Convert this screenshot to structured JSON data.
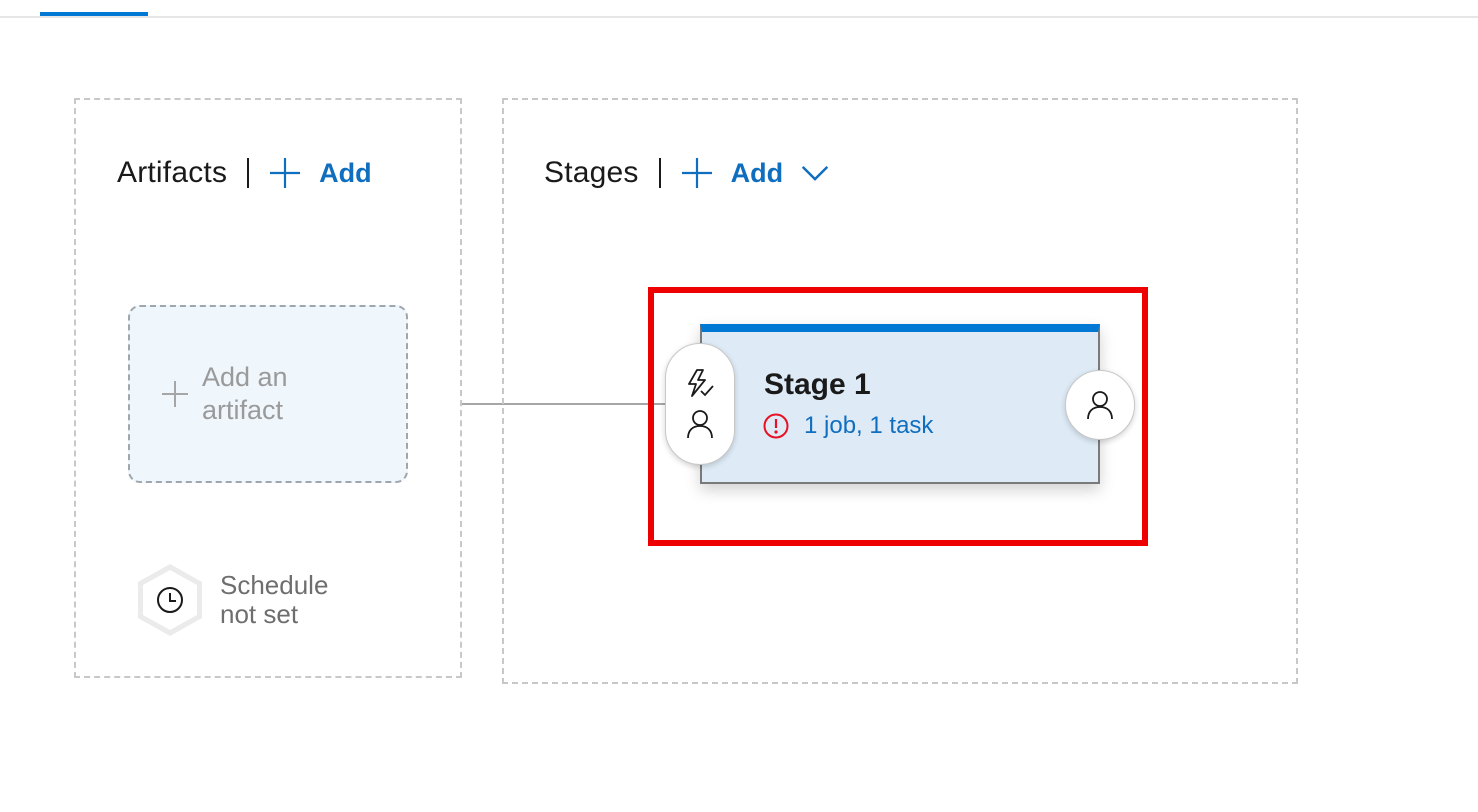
{
  "colors": {
    "accent": "#0078d4",
    "link": "#106ebe",
    "stage_background": "#deebf7",
    "warning": "#e81123",
    "highlight": "#ee0000"
  },
  "artifacts": {
    "title": "Artifacts",
    "add_label": "Add",
    "add_icon": "plus-icon",
    "placeholder_label": "Add an\nartifact",
    "schedule_label": "Schedule\nnot set",
    "schedule_icon": "clock-icon"
  },
  "stages": {
    "title": "Stages",
    "add_label": "Add",
    "add_icon": "plus-icon",
    "dropdown_icon": "chevron-down-icon",
    "items": [
      {
        "name": "Stage 1",
        "tasks_summary": "1 job, 1 task",
        "status_icon": "error-icon",
        "pre_deployment_icons": [
          "lightning-check-icon",
          "person-icon"
        ],
        "post_deployment_icon": "person-icon"
      }
    ]
  }
}
